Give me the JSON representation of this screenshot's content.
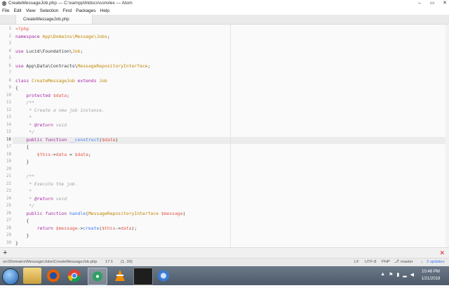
{
  "window": {
    "title": "CreateMessageJob.php — C:\\xampp\\htdocs\\convlex — Atom"
  },
  "menu": [
    "File",
    "Edit",
    "View",
    "Selection",
    "Find",
    "Packages",
    "Help"
  ],
  "tab": {
    "label": "CreateMessageJob.php"
  },
  "editor": {
    "line_numbers": [
      "1",
      "2",
      "3",
      "4",
      "5",
      "6",
      "7",
      "8",
      "9",
      "10",
      "11",
      "12",
      "13",
      "14",
      "15",
      "16",
      "17",
      "18",
      "19",
      "20",
      "21",
      "22",
      "23",
      "24",
      "25",
      "26",
      "27",
      "28",
      "29",
      "30"
    ],
    "current_line": 16
  },
  "panel": {
    "plus": "+",
    "close": "✕"
  },
  "statusbar": {
    "path": "src\\Domains\\Message\\Jobs\\CreateMessageJob.php",
    "cursor": "17:1",
    "selection": "(1, 39)",
    "line_ending": "LF",
    "encoding": "UTF-8",
    "grammar": "PHP",
    "branch": "master",
    "updates": "2 updates"
  },
  "taskbar": {
    "time": "10:46 PM",
    "date": "1/21/2018"
  },
  "colors": {
    "keyword": "#a626a4",
    "function": "#4078f2",
    "class": "#c18401",
    "variable": "#e45649",
    "comment": "#a0a1a7"
  },
  "icons": [
    "atom-icon",
    "start-orb-icon",
    "file-explorer-icon",
    "firefox-icon",
    "chrome-icon",
    "atom-taskbar-icon",
    "vlc-icon",
    "cmd-icon",
    "network-icon",
    "volume-icon"
  ]
}
